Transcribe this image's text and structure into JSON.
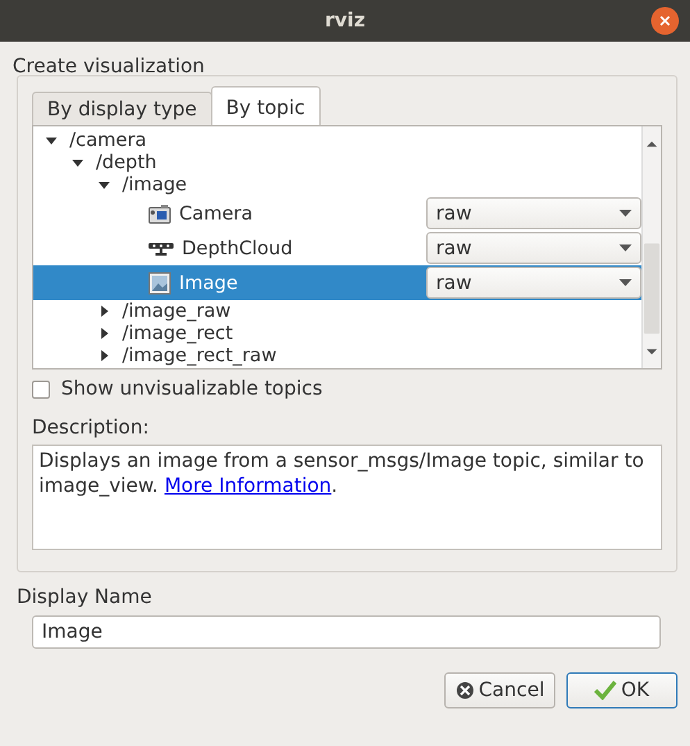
{
  "window": {
    "title": "rviz"
  },
  "heading": "Create visualization",
  "tabs": [
    {
      "label": "By display type",
      "selected": false
    },
    {
      "label": "By topic",
      "selected": true
    }
  ],
  "tree": [
    {
      "kind": "topic",
      "label": "/camera",
      "expanded": true,
      "children": [
        {
          "kind": "topic",
          "label": "/depth",
          "expanded": true,
          "children": [
            {
              "kind": "topic",
              "label": "/image",
              "expanded": true,
              "children": [
                {
                  "kind": "camera",
                  "label": "Camera",
                  "value": "raw",
                  "selected": false
                },
                {
                  "kind": "depthcloud",
                  "label": "DepthCloud",
                  "value": "raw",
                  "selected": false
                },
                {
                  "kind": "image",
                  "label": "Image",
                  "value": "raw",
                  "selected": true
                }
              ]
            },
            {
              "kind": "topic",
              "label": "/image_raw",
              "expanded": false
            },
            {
              "kind": "topic",
              "label": "/image_rect",
              "expanded": false
            },
            {
              "kind": "topic",
              "label": "/image_rect_raw",
              "expanded": false
            }
          ]
        }
      ]
    }
  ],
  "show_unvisualizable": {
    "label": "Show unvisualizable topics",
    "checked": false
  },
  "description": {
    "label": "Description:",
    "text": "Displays an image from a sensor_msgs/Image topic, similar to image_view. ",
    "link": "More Information",
    "after": "."
  },
  "display_name": {
    "label": "Display Name",
    "value": "Image"
  },
  "buttons": [
    {
      "kind": "cancel",
      "label": "Cancel"
    },
    {
      "kind": "ok",
      "label": "OK",
      "default": true
    }
  ]
}
